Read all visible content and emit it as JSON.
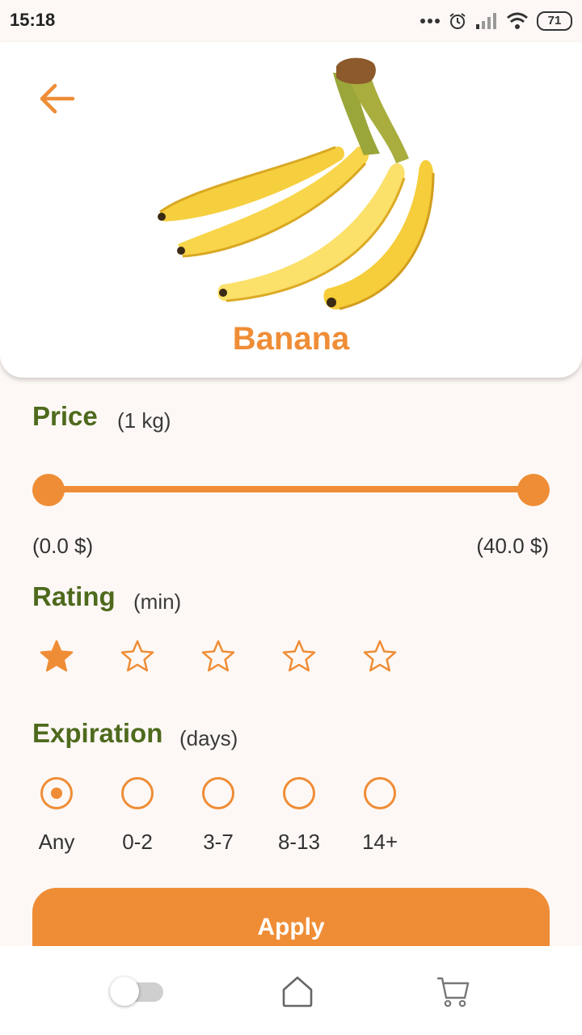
{
  "status_bar": {
    "time": "15:18",
    "battery": "71",
    "icons": [
      "more-dots-icon",
      "alarm-icon",
      "signal-icon",
      "wifi-icon",
      "battery-icon"
    ]
  },
  "header": {
    "back_icon": "arrow-left-icon",
    "image": "banana-bunch",
    "title": "Banana"
  },
  "price": {
    "title": "Price",
    "subtitle": "(1 kg)",
    "min_label": "(0.0 $)",
    "max_label": "(40.0 $)",
    "selected_min_fraction": 0.0,
    "selected_max_fraction": 1.0
  },
  "rating": {
    "title": "Rating",
    "subtitle": "(min)",
    "max_stars": 5,
    "selected": 1
  },
  "expiration": {
    "title": "Expiration",
    "subtitle": "(days)",
    "options": [
      "Any",
      "0-2",
      "3-7",
      "8-13",
      "14+"
    ],
    "selected": "Any"
  },
  "apply_button": {
    "label": "Apply"
  },
  "bottom_nav": {
    "items": [
      "toggle-switch",
      "home-icon",
      "cart-icon"
    ]
  },
  "colors": {
    "accent": "#ef8d36",
    "section_title": "#4e6a1d",
    "background": "#fdf8f5"
  }
}
